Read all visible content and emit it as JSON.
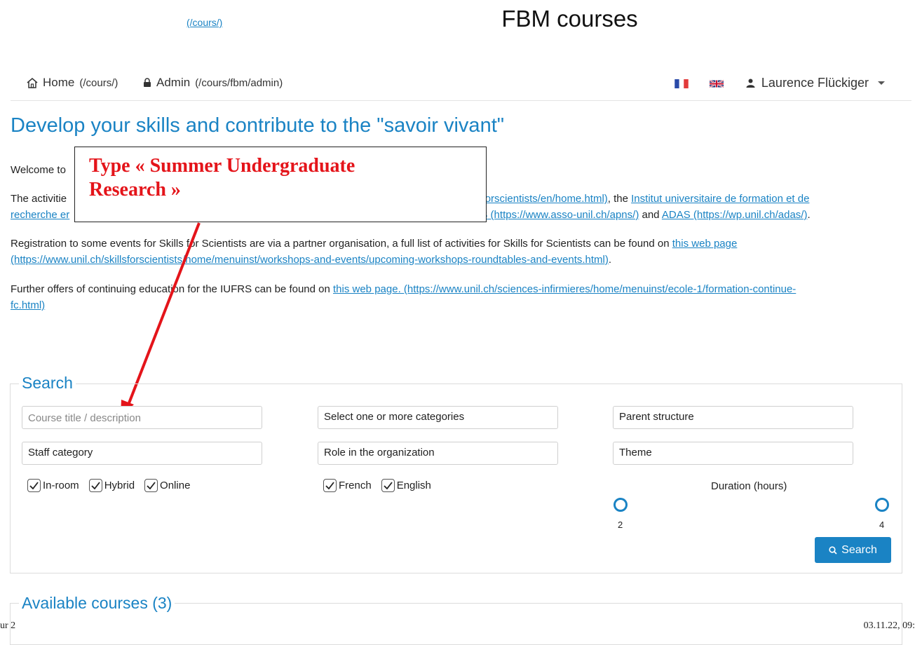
{
  "header": {
    "top_link": "(/cours/)",
    "site_title": "FBM courses"
  },
  "nav": {
    "home_label": "Home",
    "home_url": "(/cours/)",
    "admin_label": "Admin",
    "admin_url": "(/cours/fbm/admin)",
    "lang_fr": "French flag",
    "lang_en": "UK flag",
    "user_name": "Laurence Flückiger"
  },
  "main": {
    "title": "Develop your skills and contribute to the \"savoir vivant\"",
    "p1_start": "Welcome to",
    "p2_start": "The activitie",
    "p2_link1": "illsforscientists/en/home.html)",
    "p2_mid": ", the ",
    "p2_link2": "Institut universitaire de formation et de",
    "p2_line2_start": "recherche er",
    "p2_link3": "IS (https://www.asso-unil.ch/apns/)",
    "p2_and": " and ",
    "p2_link4": "ADAS (https://wp.unil.ch/adas/)",
    "p2_end": ".",
    "p3_text": "Registration to some events for Skills for Scientists are via a partner organisation, a full list of activities for Skills for Scientists can be found on ",
    "p3_link": "this web page",
    "p3_link2": "(https://www.unil.ch/skillsforscientists/home/menuinst/workshops-and-events/upcoming-workshops-roundtables-and-events.html)",
    "p3_end": ".",
    "p4_text": "Further offers of continuing education for the IUFRS can be found on ",
    "p4_link": "this web page. (https://www.unil.ch/sciences-infirmieres/home/menuinst/ecole-1/formation-continue-",
    "p4_link2": "fc.html)"
  },
  "annotation": {
    "text_line1": "Type « Summer Undergraduate",
    "text_line2": "Research »",
    "arrow_color": "#e4141a"
  },
  "search": {
    "legend": "Search",
    "course_placeholder": "Course title / description",
    "categories": "Select one or more categories",
    "parent_structure": "Parent structure",
    "staff_category": "Staff category",
    "role": "Role in the organization",
    "theme": "Theme",
    "formats": [
      "In-room",
      "Hybrid",
      "Online"
    ],
    "languages": [
      "French",
      "English"
    ],
    "duration_label": "Duration (hours)",
    "duration_min": "2",
    "duration_max": "4",
    "button_label": "Search"
  },
  "courses": {
    "legend": "Available courses (3)"
  },
  "footer": {
    "left": "ur 2",
    "right": "03.11.22, 09:"
  },
  "colors": {
    "accent": "#1a83c4",
    "annotation_red": "#e4141a"
  }
}
